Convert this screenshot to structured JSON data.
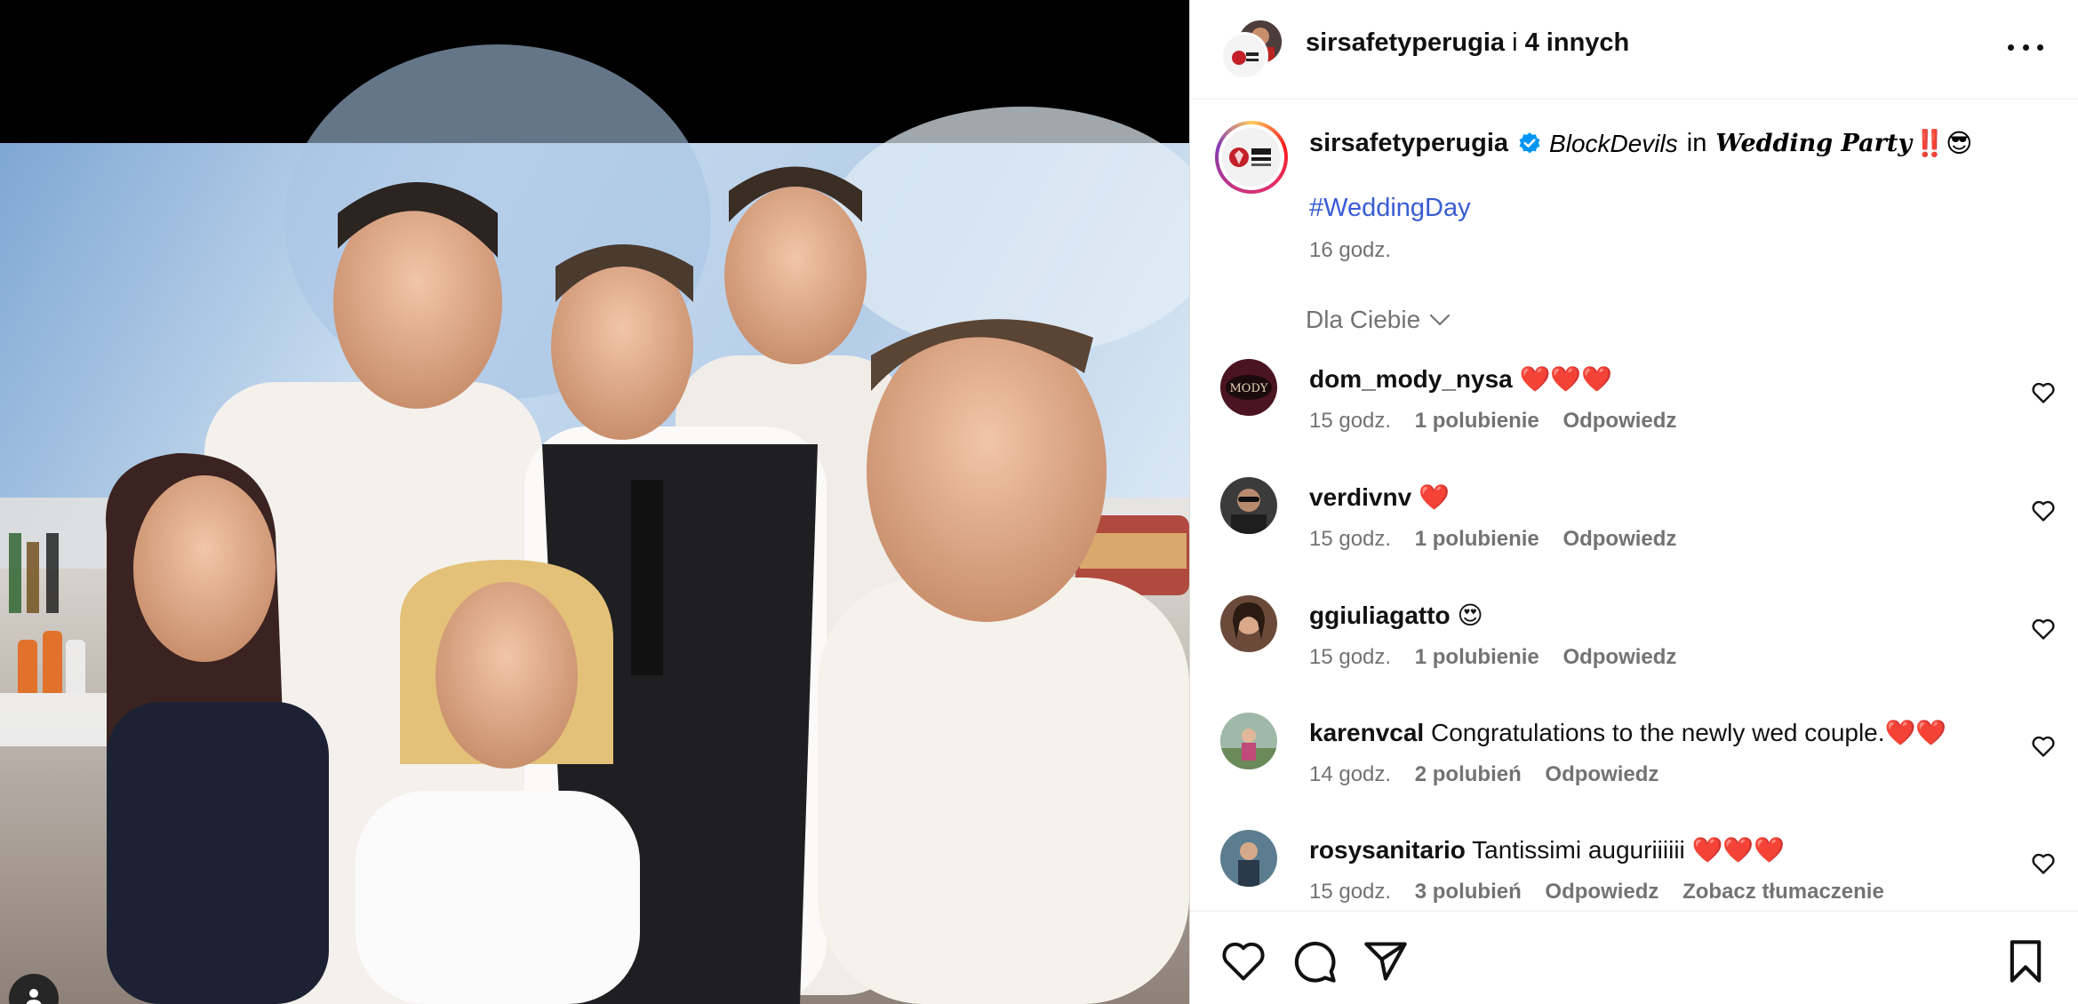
{
  "header": {
    "author": "sirsafetyperugia",
    "joiner": "i",
    "others": "4 innych"
  },
  "caption": {
    "username": "sirsafetyperugia",
    "mention": "BlockDevils",
    "in_word": "in",
    "location": "Wedding Party",
    "emoji": "‼️😎",
    "hashtag": "#WeddingDay",
    "time": "16 godz."
  },
  "sort": {
    "label": "Dla Ciebie"
  },
  "comments": [
    {
      "user": "dom_mody_nysa",
      "text": "❤️❤️❤️",
      "time": "15 godz.",
      "likes": "1 polubienie",
      "reply": "Odpowiedz",
      "translate": ""
    },
    {
      "user": "verdivnv",
      "text": "❤️",
      "time": "15 godz.",
      "likes": "1 polubienie",
      "reply": "Odpowiedz",
      "translate": ""
    },
    {
      "user": "ggiuliagatto",
      "text": "😍",
      "time": "15 godz.",
      "likes": "1 polubienie",
      "reply": "Odpowiedz",
      "translate": ""
    },
    {
      "user": "karenvcal",
      "text": "Congratulations to the newly wed couple.❤️❤️",
      "time": "14 godz.",
      "likes": "2 polubień",
      "reply": "Odpowiedz",
      "translate": ""
    },
    {
      "user": "rosysanitario",
      "text": "Tantissimi auguriiiiii ❤️❤️❤️",
      "time": "15 godz.",
      "likes": "3 polubień",
      "reply": "Odpowiedz",
      "translate": "Zobacz tłumaczenie"
    }
  ],
  "icons": {
    "more": "more-horizontal-icon",
    "like": "heart-icon",
    "comment": "comment-icon",
    "share": "send-icon",
    "save": "bookmark-icon",
    "tag": "user-tag-icon"
  },
  "colors": {
    "link": "#385cd3",
    "muted": "#737373",
    "verified": "#0095f6",
    "heart": "#e0245e"
  }
}
